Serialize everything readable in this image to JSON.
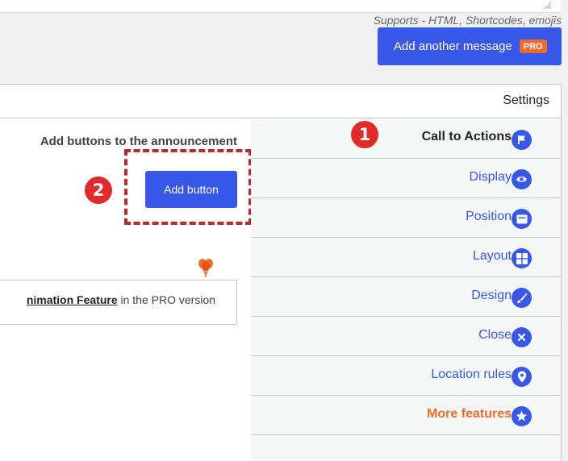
{
  "header": {
    "supports_text": "Supports - HTML, Shortcodes, emojis",
    "add_message_label": "Add another message",
    "pro_badge": "PRO"
  },
  "settings": {
    "title": "Settings"
  },
  "content": {
    "title": "Add buttons to the announcement",
    "add_button_label": "Add button",
    "notice_link": "nimation Feature",
    "notice_text": " in the PRO version"
  },
  "markers": {
    "one": "1",
    "two": "2"
  },
  "tabs": [
    {
      "label": "Call to Actions",
      "icon": "flag-icon",
      "active": true
    },
    {
      "label": "Display",
      "icon": "eye-icon"
    },
    {
      "label": "Position",
      "icon": "window-icon"
    },
    {
      "label": "Layout",
      "icon": "grid-icon"
    },
    {
      "label": "Design",
      "icon": "brush-icon"
    },
    {
      "label": "Close",
      "icon": "close-icon"
    },
    {
      "label": "Location rules",
      "icon": "location-pin-icon"
    },
    {
      "label": "More features",
      "icon": "star-icon"
    }
  ],
  "colors": {
    "accent": "#3858e9",
    "pro_orange": "#f06c2c",
    "marker_red": "#e22a2a",
    "dashed_outline": "#b32d2e"
  }
}
